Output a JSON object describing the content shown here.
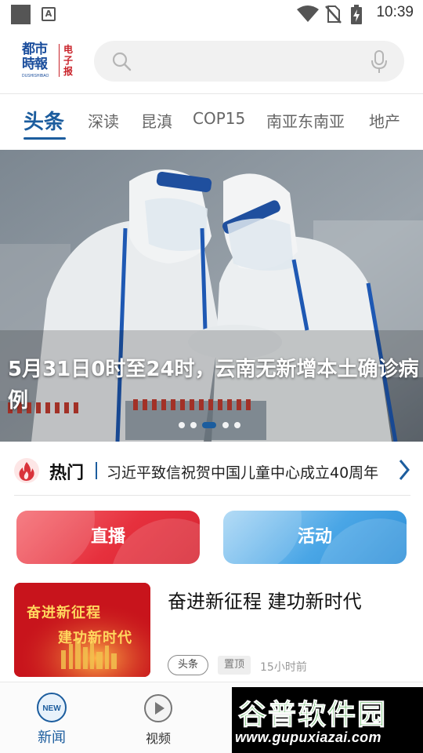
{
  "status_bar": {
    "time": "10:39",
    "icons": [
      "app-square-icon",
      "a-notification-icon",
      "wifi-icon",
      "no-sim-icon",
      "battery-charging-icon"
    ]
  },
  "header": {
    "logo_main": "都市時報",
    "logo_sub": "DUSHISHIBAO",
    "logo_side": "电子报",
    "search_placeholder": "",
    "search_icon": "search-icon",
    "mic_icon": "mic-icon"
  },
  "tabs": [
    {
      "label": "头条",
      "active": true
    },
    {
      "label": "深读"
    },
    {
      "label": "昆滇"
    },
    {
      "label": "COP15"
    },
    {
      "label": "南亚东南亚"
    },
    {
      "label": "地产"
    }
  ],
  "hero": {
    "title": "5月31日0时至24时，云南无新增本土确诊病例",
    "slide_count": 5,
    "active_slide": 3
  },
  "hot": {
    "label": "热门",
    "text": "习近平致信祝贺中国儿童中心成立40周年",
    "icon": "fire-icon"
  },
  "actions": [
    {
      "label": "直播",
      "color": "#e3313e"
    },
    {
      "label": "活动",
      "color": "#3f9fe2"
    }
  ],
  "article": {
    "title": "奋进新征程  建功新时代",
    "thumb_line1": "奋进新征程",
    "thumb_line2": "建功新时代",
    "tag": "头条",
    "pinned": "置顶",
    "time": "15小时前"
  },
  "bottom_nav": [
    {
      "label": "新闻",
      "icon": "news-new-icon",
      "active": true
    },
    {
      "label": "视频",
      "icon": "play-circle-icon",
      "active": false
    }
  ],
  "watermark": {
    "title": "谷普软件园",
    "url": "www.gupuxiazai.com"
  },
  "colors": {
    "primary": "#1c5d9e",
    "red": "#e3313e",
    "blue": "#3f9fe2"
  }
}
